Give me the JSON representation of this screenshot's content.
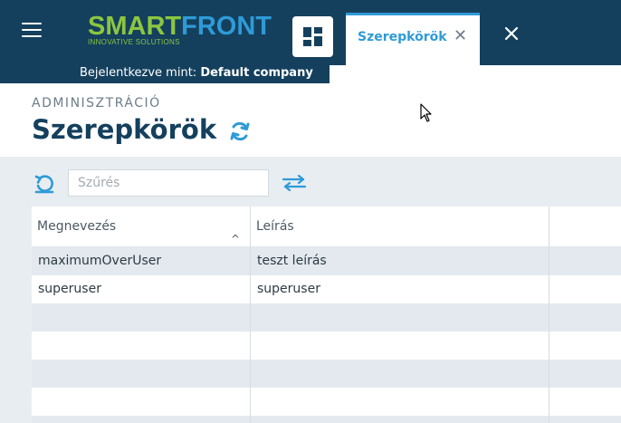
{
  "header": {
    "logo": {
      "smart": "SMART",
      "front": "FRONT",
      "tagline": "INNOVATIVE SOLUTIONS"
    },
    "menu_icon": "hamburger-icon",
    "dashboard_icon": "dashboard-icon",
    "active_tab": {
      "label": "Szerepkörök",
      "close_icon": "close-icon"
    },
    "close_all_icon": "close-icon"
  },
  "login": {
    "prefix": "Bejelentkezve mint:",
    "company": "Default company"
  },
  "page": {
    "breadcrumb": "ADMINISZTRÁCIÓ",
    "title": "Szerepkörök",
    "refresh_icon": "refresh-icon"
  },
  "toolbar": {
    "reset_icon": "undo-icon",
    "filter_placeholder": "Szűrés",
    "filter_value": "",
    "swap_icon": "swap-arrows-icon"
  },
  "table": {
    "columns": [
      "Megnevezés",
      "Leírás"
    ],
    "sort_indicator": "^",
    "rows": [
      [
        "maximumOverUser",
        "teszt leírás"
      ],
      [
        "superuser",
        "superuser"
      ],
      [
        "",
        ""
      ],
      [
        "",
        ""
      ],
      [
        "",
        ""
      ],
      [
        "",
        ""
      ],
      [
        "",
        ""
      ]
    ]
  },
  "colors": {
    "header_bg": "#14405e",
    "accent": "#2e9bd6",
    "logo_green": "#8cc63f",
    "content_bg": "#e8edf2",
    "row_alt": "#e3e9ef"
  }
}
